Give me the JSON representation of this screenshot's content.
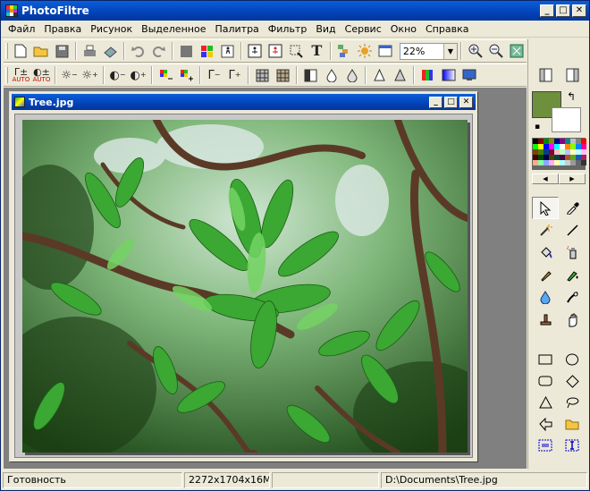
{
  "app": {
    "title": "PhotoFiltre"
  },
  "window_buttons": {
    "minimize": "_",
    "maximize": "□",
    "close": "✕"
  },
  "menu": [
    "Файл",
    "Правка",
    "Рисунок",
    "Выделенное",
    "Палитра",
    "Фильтр",
    "Вид",
    "Сервис",
    "Окно",
    "Справка"
  ],
  "toolbar": {
    "zoom": "22%",
    "auto_label": "AUTO"
  },
  "document": {
    "title": "Tree.jpg"
  },
  "status": {
    "ready": "Готовность",
    "size": "2272x1704x16M",
    "extra": "",
    "path": "D:\\Documents\\Tree.jpg"
  },
  "colors": {
    "foreground": "#6e8f3c",
    "background": "#ffffff",
    "titlebar": "#0342b8"
  },
  "icons": {
    "tb1": [
      "new-file-icon",
      "open-folder-icon",
      "save-icon",
      "print-icon",
      "scan-icon",
      "undo-icon",
      "redo-icon",
      "color-square-icon",
      "palette-icon",
      "run-icon",
      "image-size-icon",
      "canvas-size-icon",
      "crop-icon",
      "text-icon",
      "layers-icon",
      "sun-icon",
      "window-icon",
      "zoom-in-icon",
      "zoom-out-icon",
      "fit-icon"
    ],
    "tb2": [
      "brightness-auto-icon",
      "contrast-auto-icon",
      "brightness-minus-icon",
      "brightness-plus-icon",
      "contrast-minus-icon",
      "contrast-plus-icon",
      "saturation-minus-icon",
      "saturation-plus-icon",
      "gamma-minus-icon",
      "gamma-plus-icon",
      "grid-icon",
      "grid2-icon",
      "half-icon",
      "drop-icon",
      "drop2-icon",
      "triangle-icon",
      "triangle2-icon",
      "colorbar-icon",
      "gradient-icon",
      "screen-icon"
    ],
    "tools": [
      "select-arrow-icon",
      "eyedropper-icon",
      "magic-wand-icon",
      "line-icon",
      "fill-bucket-icon",
      "spray-icon",
      "brush-icon",
      "pen-icon",
      "blur-drop-icon",
      "smudge-icon",
      "stamp-icon",
      "hand-icon"
    ],
    "shapes": [
      "rectangle-icon",
      "ellipse-icon",
      "rounded-rect-icon",
      "diamond-icon",
      "triangle-shape-icon",
      "lasso-icon",
      "polygon-icon",
      "folder-icon",
      "select-rect-icon",
      "select-text-icon"
    ]
  }
}
